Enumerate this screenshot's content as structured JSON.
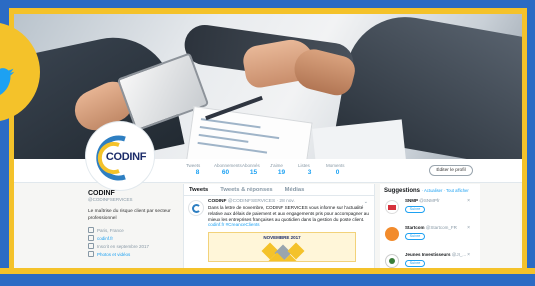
{
  "profile": {
    "logo_text": "CODINF",
    "name": "CODINF",
    "handle": "@CODINFSERVICES",
    "bio": "Le maîtrise du risque client par secteur professionnel",
    "location": "Paris, France",
    "website": "codinf.fr",
    "joined": "Inscrit en septembre 2017",
    "photos_label": "Photos et vidéos"
  },
  "stats": [
    {
      "label": "Tweets",
      "value": "8"
    },
    {
      "label": "Abonnements",
      "value": "60"
    },
    {
      "label": "Abonnés",
      "value": "15"
    },
    {
      "label": "J'aime",
      "value": "19"
    },
    {
      "label": "Listes",
      "value": "3"
    },
    {
      "label": "Moments",
      "value": "0"
    }
  ],
  "edit_button": "Éditer le profil",
  "tabs": [
    "Tweets",
    "Tweets & réponses",
    "Médias"
  ],
  "tweet": {
    "author": "CODINF",
    "handle": "@CODINFSERVICES · 28 nov.",
    "body": "Dans la lettre de novembre, CODINF SERVICES vous informe sur l'actualité relative aux délais de paiement et aux engagements pris pour accompagner au mieux les entreprises françaises au quotidien dans la gestion du poste client.",
    "link": "codinf.fr",
    "link2": "#CreanceClients",
    "card_title": "NOVEMBRE 2017"
  },
  "suggestions": {
    "title": "Suggestions",
    "actions": "· Actualiser · Tout afficher",
    "items": [
      {
        "name": "SNMP",
        "handle": "@SNMPfr",
        "button": "Suivre"
      },
      {
        "name": "Startcom",
        "handle": "@Startcom_FR",
        "button": "Suivre"
      },
      {
        "name": "Jeunes Investisseurs",
        "handle": "@JI_...",
        "button": "Suivre"
      }
    ]
  },
  "colors": {
    "frame_blue": "#2b6bc4",
    "frame_yellow": "#f4c22a",
    "twitter_blue": "#1da1f2"
  }
}
